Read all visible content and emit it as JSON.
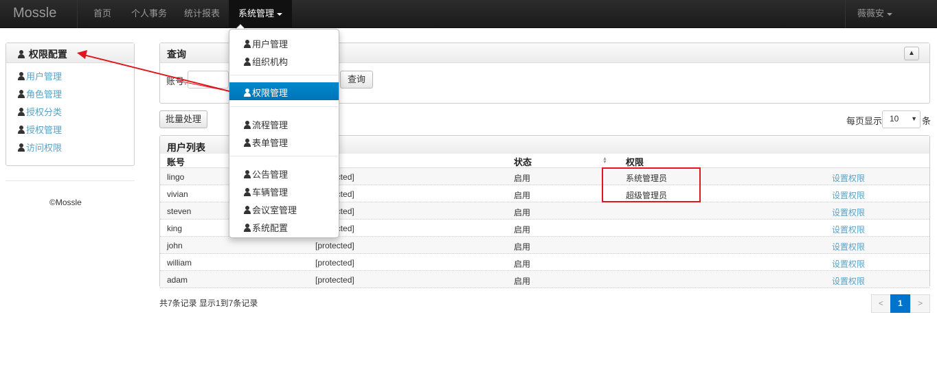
{
  "navbar": {
    "brand": "Mossle",
    "items": [
      {
        "label": "首页"
      },
      {
        "label": "个人事务"
      },
      {
        "label": "统计报表"
      },
      {
        "label": "系统管理"
      }
    ],
    "user": "薇薇安"
  },
  "sidebar": {
    "title": "权限配置",
    "items": [
      {
        "label": "用户管理"
      },
      {
        "label": "角色管理"
      },
      {
        "label": "授权分类"
      },
      {
        "label": "授权管理"
      },
      {
        "label": "访问权限"
      }
    ],
    "copyright": "©Mossle"
  },
  "query": {
    "title": "查询",
    "account_label": "账号:",
    "search_label": "查询"
  },
  "toolbar": {
    "batch_label": "批量处理",
    "per_page_label": "每页显示",
    "per_page_value": "10",
    "per_page_unit": "条"
  },
  "table": {
    "title": "用户列表",
    "headers": {
      "account": "账号",
      "status": "状态",
      "role": "权限"
    },
    "rows": [
      {
        "account": "lingo",
        "password": "[protected]",
        "status": "启用",
        "role": "系统管理员",
        "action": "设置权限"
      },
      {
        "account": "vivian",
        "password": "[protected]",
        "status": "启用",
        "role": "超级管理员",
        "action": "设置权限"
      },
      {
        "account": "steven",
        "password": "[protected]",
        "status": "启用",
        "role": "",
        "action": "设置权限"
      },
      {
        "account": "king",
        "password": "[protected]",
        "status": "启用",
        "role": "",
        "action": "设置权限"
      },
      {
        "account": "john",
        "password": "[protected]",
        "status": "启用",
        "role": "",
        "action": "设置权限"
      },
      {
        "account": "william",
        "password": "[protected]",
        "status": "启用",
        "role": "",
        "action": "设置权限"
      },
      {
        "account": "adam",
        "password": "[protected]",
        "status": "启用",
        "role": "",
        "action": "设置权限"
      }
    ]
  },
  "summary": "共7条记录 显示1到7条记录",
  "pager": {
    "prev": "<",
    "current": "1",
    "next": ">"
  },
  "dropdown": {
    "items": [
      {
        "label": "用户管理"
      },
      {
        "label": "组织机构"
      },
      {
        "label": "权限管理"
      },
      {
        "label": "流程管理"
      },
      {
        "label": "表单管理"
      },
      {
        "label": "公告管理"
      },
      {
        "label": "车辆管理"
      },
      {
        "label": "会议室管理"
      },
      {
        "label": "系统配置"
      }
    ]
  },
  "colors": {
    "link": "#5aa3c7",
    "active": "#0088cc",
    "annotation": "#e0151d"
  }
}
